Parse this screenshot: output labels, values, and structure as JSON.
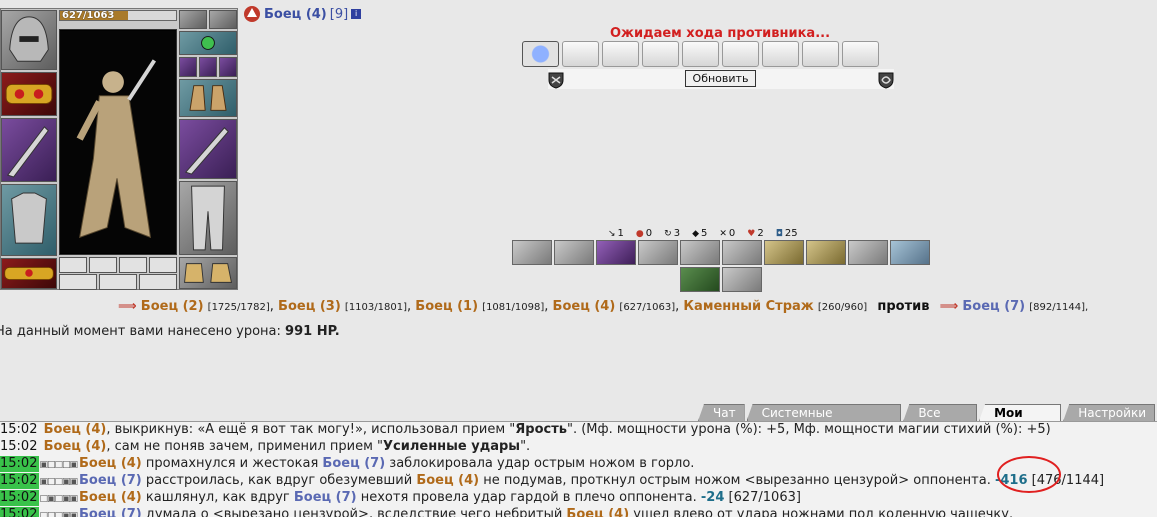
{
  "character": {
    "hp_text": "627/1063",
    "hp_fraction": 0.59
  },
  "header": {
    "name": "Боец (4)",
    "level": "[9]",
    "info_glyph": "i"
  },
  "battle": {
    "waiting_text": "Ожидаем хода противника...",
    "refresh_label": "Обновить"
  },
  "stats": [
    {
      "icon": "dagger-icon",
      "glyph": "↘",
      "value": "1"
    },
    {
      "icon": "blood-drop-icon",
      "glyph": "●",
      "value": "0"
    },
    {
      "icon": "counter-icon",
      "glyph": "↻",
      "value": "3"
    },
    {
      "icon": "block-icon",
      "glyph": "◆",
      "value": "5"
    },
    {
      "icon": "cross-swords-icon",
      "glyph": "✕",
      "value": "0"
    },
    {
      "icon": "heart-icon",
      "glyph": "♥",
      "value": "2"
    },
    {
      "icon": "shield-stat-icon",
      "glyph": "◘",
      "value": "25"
    }
  ],
  "teams": {
    "arrow": "⟹",
    "team_a": [
      {
        "name": "Боец (2)",
        "hp": "[1725/1782]",
        "sep": ","
      },
      {
        "name": "Боец (3)",
        "hp": "[1103/1801]",
        "sep": ","
      },
      {
        "name": "Боец (1)",
        "hp": "[1081/1098]",
        "sep": ","
      },
      {
        "name": "Боец (4)",
        "hp": "[627/1063]",
        "sep": ","
      },
      {
        "name": "Каменный Страж",
        "hp": "[260/960]",
        "sep": ""
      }
    ],
    "versus": "против",
    "team_b": [
      {
        "name": "Боец (7)",
        "hp": "[892/1144],",
        "sep": ""
      }
    ]
  },
  "damage": {
    "prefix": "На данный момент вами нанесено урона:",
    "value": "991 HP."
  },
  "tabs": [
    {
      "label": "Чат",
      "active": false
    },
    {
      "label": "Системные сообщения",
      "active": false
    },
    {
      "label": "Все логи",
      "active": false
    },
    {
      "label": "Мои логи",
      "active": true
    },
    {
      "label": "Настройки",
      "active": false
    }
  ],
  "log": [
    {
      "ts": "15:02",
      "green": false,
      "markers": "",
      "parts": [
        {
          "t": "Боец (4)",
          "c": "a"
        },
        {
          "t": ", выкрикнув: «А ещё я вот так могу!», использовал прием \"",
          "c": ""
        },
        {
          "t": "Ярость",
          "c": "skill-name"
        },
        {
          "t": "\". (Мф. мощности урона (%): +5, Мф. мощности магии стихий (%): +5)",
          "c": ""
        }
      ]
    },
    {
      "ts": "15:02",
      "green": false,
      "markers": "",
      "parts": [
        {
          "t": "Боец (4)",
          "c": "a"
        },
        {
          "t": ", сам не поняв зачем, применил прием \"",
          "c": ""
        },
        {
          "t": "Усиленные удары",
          "c": "skill-name"
        },
        {
          "t": "\".",
          "c": ""
        }
      ]
    },
    {
      "ts": "15:02",
      "green": true,
      "markers": "▣□□□▣",
      "parts": [
        {
          "t": "Боец (4)",
          "c": "a"
        },
        {
          "t": " промахнулся и жестокая ",
          "c": ""
        },
        {
          "t": "Боец (7)",
          "c": "b"
        },
        {
          "t": " заблокировала удар острым ножом в горло.",
          "c": ""
        }
      ]
    },
    {
      "ts": "15:02",
      "green": true,
      "markers": "▣□□▣▣",
      "parts": [
        {
          "t": "Боец (7)",
          "c": "b"
        },
        {
          "t": " расстроилась, как вдруг обезумевший ",
          "c": ""
        },
        {
          "t": "Боец (4)",
          "c": "a"
        },
        {
          "t": " не подумав, проткнул острым ножом <вырезанно цензурой> оппонента. ",
          "c": ""
        },
        {
          "t": "-416",
          "c": "dmg"
        },
        {
          "t": " [476/1144]",
          "c": ""
        }
      ]
    },
    {
      "ts": "15:02",
      "green": true,
      "markers": "□▣□▣▣",
      "parts": [
        {
          "t": "Боец (4)",
          "c": "a"
        },
        {
          "t": " кашлянул, как вдруг ",
          "c": ""
        },
        {
          "t": "Боец (7)",
          "c": "b"
        },
        {
          "t": " нехотя провела удар гардой в плечо оппонента. ",
          "c": ""
        },
        {
          "t": "-24",
          "c": "dmg"
        },
        {
          "t": " [627/1063]",
          "c": ""
        }
      ]
    },
    {
      "ts": "15:02",
      "green": true,
      "markers": "□□□▣▣",
      "parts": [
        {
          "t": "Боец (7)",
          "c": "b"
        },
        {
          "t": " думала о <вырезано цензурой>, вследствие чего небритый ",
          "c": ""
        },
        {
          "t": "Боец (4)",
          "c": "a"
        },
        {
          "t": " ушел влево от удара ножнами под коленную чашечку.",
          "c": ""
        }
      ]
    }
  ]
}
